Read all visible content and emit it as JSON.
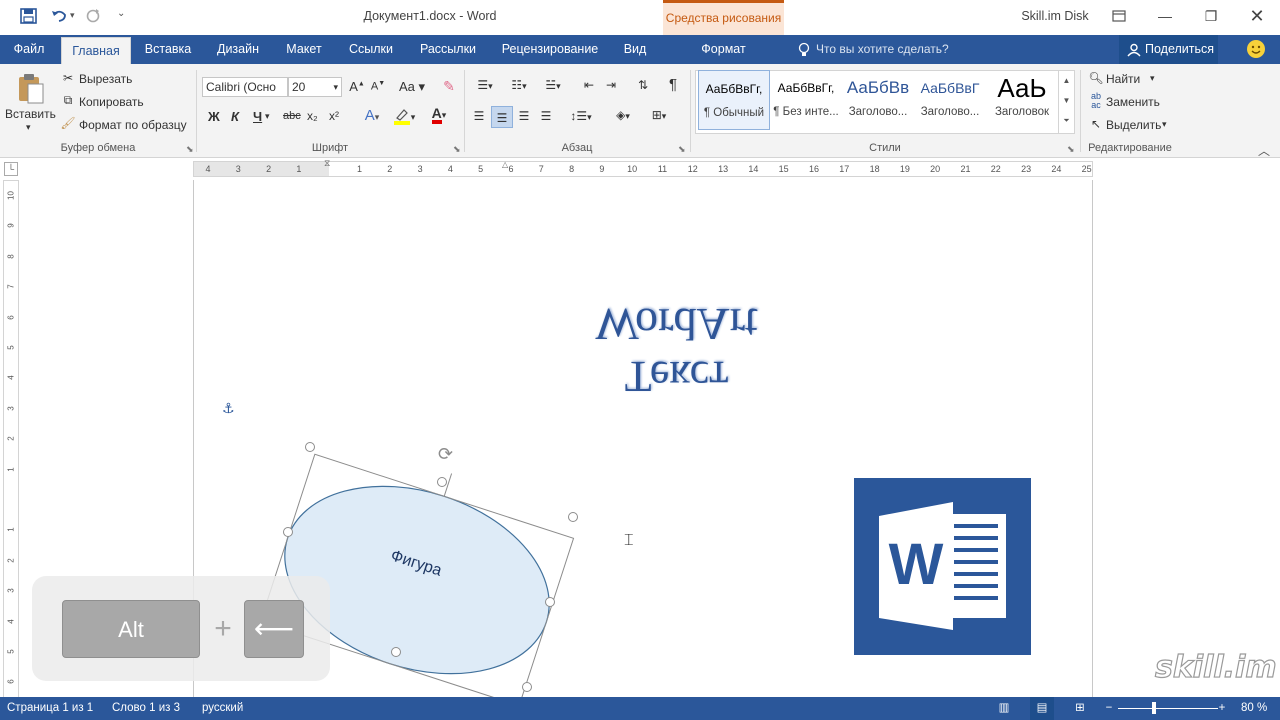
{
  "titlebar": {
    "title": "Документ1.docx  -  Word",
    "context_tab": "Средства рисования",
    "account": "Skill.im Disk"
  },
  "tabs": [
    {
      "label": "Файл"
    },
    {
      "label": "Главная"
    },
    {
      "label": "Вставка"
    },
    {
      "label": "Дизайн"
    },
    {
      "label": "Макет"
    },
    {
      "label": "Ссылки"
    },
    {
      "label": "Рассылки"
    },
    {
      "label": "Рецензирование"
    },
    {
      "label": "Вид"
    },
    {
      "label": "Формат"
    }
  ],
  "tell_me": {
    "placeholder": "Что вы хотите сделать?"
  },
  "share": {
    "label": "Поделиться"
  },
  "clipboard": {
    "paste": "Вставить",
    "cut": "Вырезать",
    "copy": "Копировать",
    "format_painter": "Формат по образцу",
    "label": "Буфер обмена"
  },
  "font": {
    "name": "Calibri (Осно",
    "size": "20",
    "label": "Шрифт",
    "bold": "Ж",
    "italic": "К",
    "underline": "Ч",
    "strike": "abc",
    "subscript": "x₂",
    "superscript": "x²"
  },
  "paragraph": {
    "label": "Абзац"
  },
  "styles": {
    "label": "Стили",
    "items": [
      {
        "preview": "АаБбВвГг,",
        "name": "¶ Обычный"
      },
      {
        "preview": "АаБбВвГг,",
        "name": "¶ Без инте..."
      },
      {
        "preview": "АаБбВв",
        "name": "Заголово..."
      },
      {
        "preview": "АаБбВвГ",
        "name": "Заголово..."
      },
      {
        "preview": "АаЬ",
        "name": "Заголовок"
      }
    ]
  },
  "editing": {
    "find": "Найти",
    "replace": "Заменить",
    "select": "Выделить",
    "label": "Редактирование"
  },
  "ruler": {
    "h_ticks": [
      "4",
      "3",
      "2",
      "1",
      "",
      "1",
      "2",
      "3",
      "4",
      "5",
      "6",
      "7",
      "8",
      "9",
      "10",
      "11",
      "12",
      "13",
      "14",
      "15",
      "16",
      "17",
      "18",
      "19",
      "20",
      "21",
      "22",
      "23",
      "24",
      "25"
    ],
    "v_ticks": [
      "10",
      "9",
      "8",
      "7",
      "6",
      "5",
      "4",
      "3",
      "2",
      "1",
      "",
      "1",
      "2",
      "3",
      "4",
      "5",
      "6"
    ]
  },
  "document": {
    "wordart_line1": "Текст",
    "wordart_line2": "WordArt",
    "shape_text": "Фигура"
  },
  "keys": {
    "alt": "Alt",
    "plus": "+",
    "arrow": "⟵"
  },
  "watermark": "skill.im",
  "status": {
    "page": "Страница 1 из 1",
    "words": "Слово 1 из 3",
    "lang": "русский",
    "zoom": "80 %"
  },
  "colors": {
    "brand": "#2b579a",
    "context": "#c55a11",
    "shape_fill": "#deebf7",
    "wordart": "#2f5597"
  }
}
